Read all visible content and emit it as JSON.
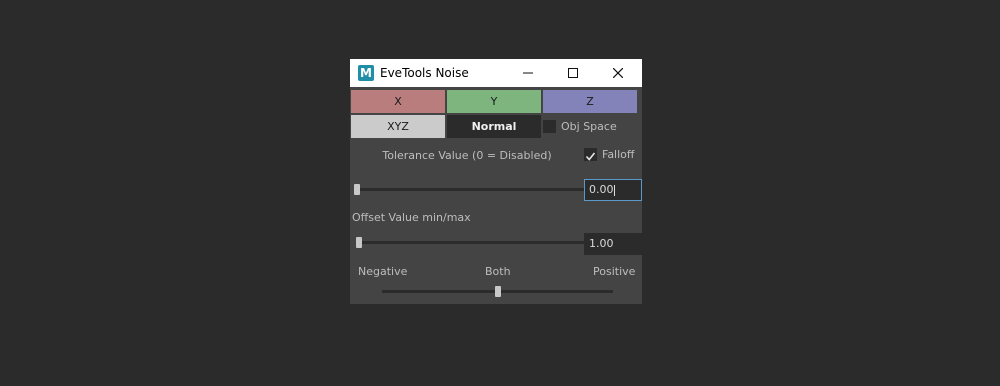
{
  "window": {
    "title": "EveTools Noise",
    "icon_letter": "M",
    "controls": [
      "minimize-icon",
      "maximize-icon",
      "close-icon"
    ]
  },
  "axis_buttons": {
    "x_label": "X",
    "y_label": "Y",
    "z_label": "Z",
    "x_color": "#b97d7d",
    "y_color": "#7eb47e",
    "z_color": "#8383b9"
  },
  "mode_buttons": {
    "xyz_label": "XYZ",
    "normal_label": "Normal",
    "obj_space_label": "Obj Space",
    "obj_space_checked": false
  },
  "tolerance": {
    "label": "Tolerance Value (0 = Disabled)",
    "falloff_label": "Falloff",
    "falloff_checked": true,
    "value": "0.00",
    "slider_fraction": 0.0
  },
  "offset": {
    "label": "Offset Value min/max",
    "value": "1.00",
    "slider_fraction": 0.0
  },
  "direction": {
    "negative_label": "Negative",
    "both_label": "Both",
    "positive_label": "Positive",
    "slider_fraction": 0.5
  }
}
